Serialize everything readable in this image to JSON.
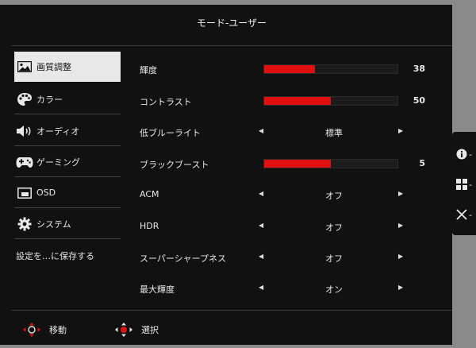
{
  "header": {
    "title": "モード-ユーザー"
  },
  "sidebar": {
    "items": [
      {
        "label": "画質調整",
        "icon": "picture-icon"
      },
      {
        "label": "カラー",
        "icon": "palette-icon"
      },
      {
        "label": "オーディオ",
        "icon": "speaker-icon"
      },
      {
        "label": "ゲーミング",
        "icon": "gamepad-icon"
      },
      {
        "label": "OSD",
        "icon": "osd-window-icon"
      },
      {
        "label": "システム",
        "icon": "gear-icon"
      },
      {
        "label": "設定を…に保存する"
      }
    ]
  },
  "settings": [
    {
      "label": "輝度",
      "type": "slider",
      "value": 38,
      "display": "38"
    },
    {
      "label": "コントラスト",
      "type": "slider",
      "value": 50,
      "display": "50"
    },
    {
      "label": "低ブルーライト",
      "type": "option",
      "display": "標準"
    },
    {
      "label": "ブラックブースト",
      "type": "slider",
      "value": 5,
      "max": 10,
      "display": "5"
    },
    {
      "label": "ACM",
      "type": "option",
      "display": "オフ"
    },
    {
      "label": "HDR",
      "type": "option",
      "display": "オフ"
    },
    {
      "label": "スーパーシャープネス",
      "type": "option",
      "display": "オフ"
    },
    {
      "label": "最大輝度",
      "type": "option",
      "display": "オン"
    }
  ],
  "footer": {
    "move_label": "移動",
    "select_label": "選択"
  },
  "side_buttons": {
    "info_suffix": "-",
    "menu_suffix": "-",
    "close_suffix": "-"
  },
  "colors": {
    "accent": "#e01010",
    "background": "#111111",
    "bezel": "#8a8a8a"
  }
}
